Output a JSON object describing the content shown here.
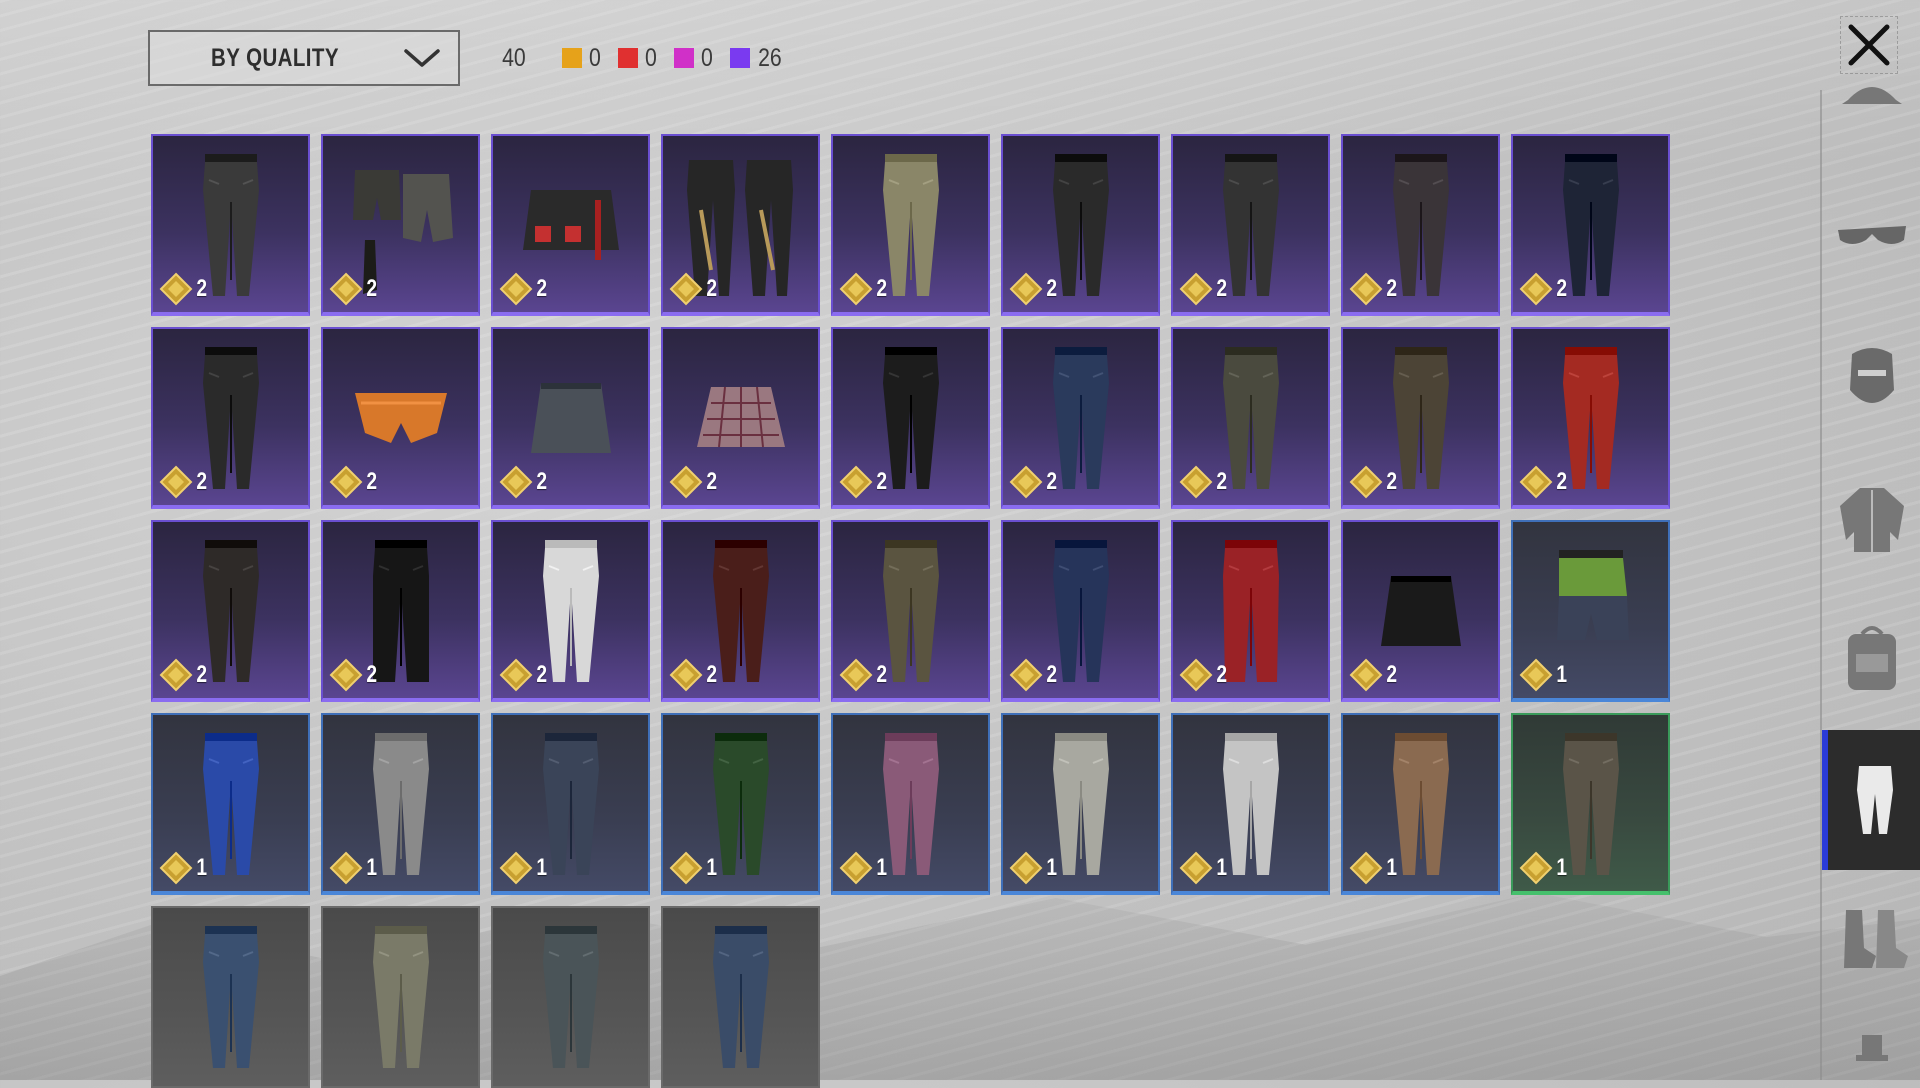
{
  "filter": {
    "sort_label": "BY QUALITY",
    "total": "40",
    "counts": [
      {
        "color": "#e6a21a",
        "value": "0"
      },
      {
        "color": "#e03030",
        "value": "0"
      },
      {
        "color": "#d030c8",
        "value": "0"
      },
      {
        "color": "#7a3af0",
        "value": "26"
      }
    ]
  },
  "items": [
    {
      "tier": "purple",
      "qty": "2",
      "kind": "pants",
      "color": "#3a3a3a"
    },
    {
      "tier": "purple",
      "qty": "2",
      "kind": "shorts-boots",
      "color": "#3a3a36"
    },
    {
      "tier": "purple",
      "qty": "2",
      "kind": "skirt",
      "color": "#2a2a2a"
    },
    {
      "tier": "purple",
      "qty": "2",
      "kind": "pants-pair",
      "color": "#262626"
    },
    {
      "tier": "purple",
      "qty": "2",
      "kind": "pants",
      "color": "#8a8668"
    },
    {
      "tier": "purple",
      "qty": "2",
      "kind": "pants",
      "color": "#2a2a2a"
    },
    {
      "tier": "purple",
      "qty": "2",
      "kind": "pants",
      "color": "#333"
    },
    {
      "tier": "purple",
      "qty": "2",
      "kind": "pants",
      "color": "#3a3438"
    },
    {
      "tier": "purple",
      "qty": "2",
      "kind": "pants",
      "color": "#1e2436"
    },
    {
      "tier": "purple",
      "qty": "2",
      "kind": "pants",
      "color": "#2a2a2a"
    },
    {
      "tier": "purple",
      "qty": "2",
      "kind": "briefs",
      "color": "#d8782a"
    },
    {
      "tier": "purple",
      "qty": "2",
      "kind": "miniskirt",
      "color": "#4a5058"
    },
    {
      "tier": "purple",
      "qty": "2",
      "kind": "pleated",
      "color": "#9a7880"
    },
    {
      "tier": "purple",
      "qty": "2",
      "kind": "pants",
      "color": "#1c1c1c"
    },
    {
      "tier": "purple",
      "qty": "2",
      "kind": "pants",
      "color": "#2a3a5c"
    },
    {
      "tier": "purple",
      "qty": "2",
      "kind": "pants",
      "color": "#4a4a3e"
    },
    {
      "tier": "purple",
      "qty": "2",
      "kind": "pants",
      "color": "#4c4436"
    },
    {
      "tier": "purple",
      "qty": "2",
      "kind": "pants",
      "color": "#a42a22"
    },
    {
      "tier": "purple",
      "qty": "2",
      "kind": "pants",
      "color": "#2e2a28"
    },
    {
      "tier": "purple",
      "qty": "2",
      "kind": "flare",
      "color": "#161616"
    },
    {
      "tier": "purple",
      "qty": "2",
      "kind": "pants",
      "color": "#d8d8d8"
    },
    {
      "tier": "purple",
      "qty": "2",
      "kind": "pants",
      "color": "#4a1e1a"
    },
    {
      "tier": "purple",
      "qty": "2",
      "kind": "pants",
      "color": "#5a5440"
    },
    {
      "tier": "purple",
      "qty": "2",
      "kind": "pants",
      "color": "#26345a"
    },
    {
      "tier": "purple",
      "qty": "2",
      "kind": "wide",
      "color": "#9a2226"
    },
    {
      "tier": "purple",
      "qty": "2",
      "kind": "miniskirt",
      "color": "#1a1a1a"
    },
    {
      "tier": "blue",
      "qty": "1",
      "kind": "shorts",
      "color": "#6a9a3a"
    },
    {
      "tier": "blue",
      "qty": "1",
      "kind": "pants",
      "color": "#2a4aa8"
    },
    {
      "tier": "blue",
      "qty": "1",
      "kind": "pants",
      "color": "#8a8a8a"
    },
    {
      "tier": "blue",
      "qty": "1",
      "kind": "pants",
      "color": "#3a4458"
    },
    {
      "tier": "blue",
      "qty": "1",
      "kind": "pants",
      "color": "#2a4a2a"
    },
    {
      "tier": "blue",
      "qty": "1",
      "kind": "pants",
      "color": "#8a5a78"
    },
    {
      "tier": "blue",
      "qty": "1",
      "kind": "pants",
      "color": "#a8a8a0"
    },
    {
      "tier": "blue",
      "qty": "1",
      "kind": "pants",
      "color": "#c4c4c4"
    },
    {
      "tier": "blue",
      "qty": "1",
      "kind": "pants",
      "color": "#8a6a50"
    },
    {
      "tier": "green",
      "qty": "1",
      "kind": "pants",
      "color": "#5a5448"
    },
    {
      "tier": "gray",
      "qty": "",
      "kind": "pants",
      "color": "#3a5070"
    },
    {
      "tier": "gray",
      "qty": "",
      "kind": "pants",
      "color": "#7a7a68"
    },
    {
      "tier": "gray",
      "qty": "",
      "kind": "pants",
      "color": "#4a5458"
    },
    {
      "tier": "gray",
      "qty": "",
      "kind": "pants",
      "color": "#3a4c68"
    }
  ],
  "sidebar": {
    "categories": [
      {
        "id": "headwear",
        "icon": "cap-icon"
      },
      {
        "id": "eyewear",
        "icon": "glasses-icon"
      },
      {
        "id": "mask",
        "icon": "mask-icon"
      },
      {
        "id": "top",
        "icon": "jacket-icon"
      },
      {
        "id": "backpack",
        "icon": "backpack-icon"
      },
      {
        "id": "pants",
        "icon": "pants-icon",
        "active": true
      },
      {
        "id": "shoes",
        "icon": "boots-icon"
      },
      {
        "id": "more",
        "icon": "misc-icon"
      }
    ]
  }
}
